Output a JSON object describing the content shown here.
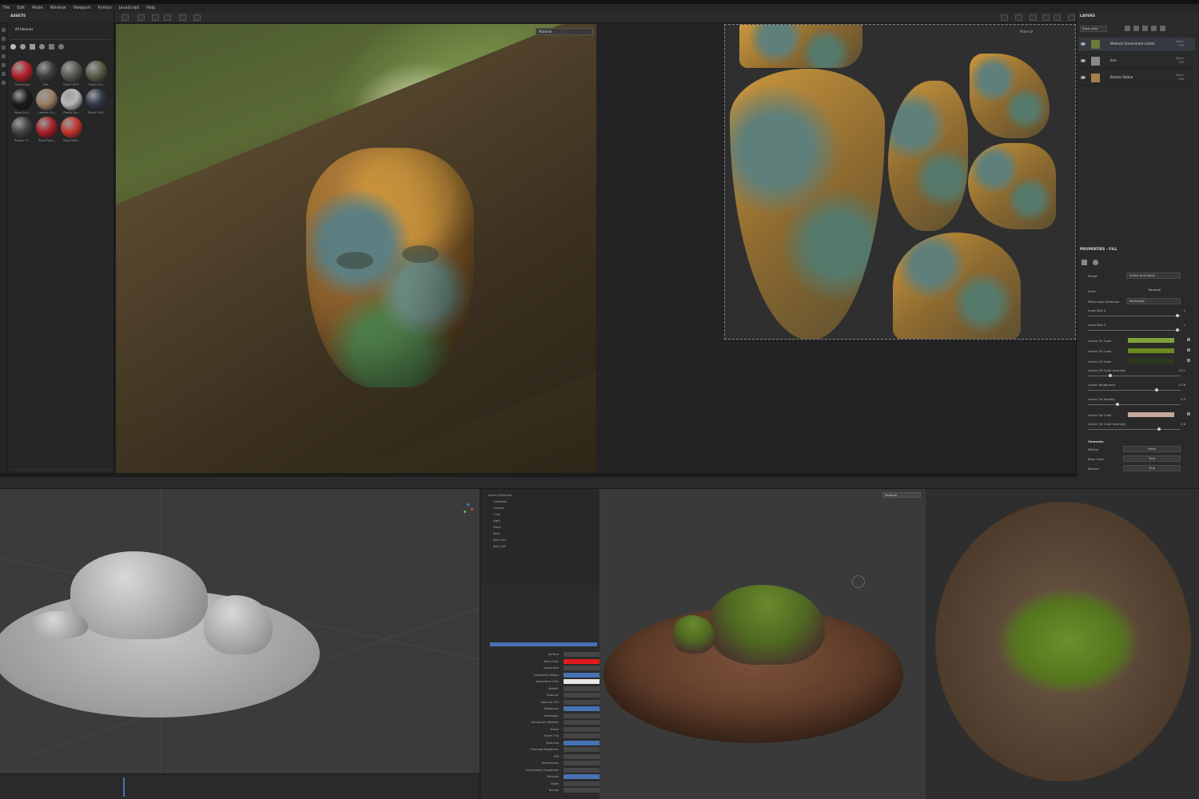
{
  "menu": [
    "File",
    "Edit",
    "Mode",
    "Window",
    "Viewport",
    "Python",
    "JavaScript",
    "Help"
  ],
  "assets": {
    "title": "ASSETS",
    "library": "All libraries",
    "materials": [
      {
        "label": "Aluminium",
        "color": "#b5202a"
      },
      {
        "label": "Bre...",
        "color": "#3c3c3c"
      },
      {
        "label": "Fabric UCP...",
        "color": "#5a5a52"
      },
      {
        "label": "Fabric Kni...",
        "color": "#5b5a45"
      },
      {
        "label": "Glass Sun...",
        "color": "#1a1a1a"
      },
      {
        "label": "Leather Sa...",
        "color": "#9a7c62"
      },
      {
        "label": "Plastic Dur...",
        "color": "#b8b8b8"
      },
      {
        "label": "Plastic Soft...",
        "color": "#303848"
      },
      {
        "label": "Rubber Ti...",
        "color": "#424242"
      },
      {
        "label": "Steel Paint...",
        "color": "#a62028"
      },
      {
        "label": "Steel Paint...",
        "color": "#c2342c"
      }
    ]
  },
  "viewport_3d": {
    "dropdown": "Material"
  },
  "uv_viewport": {
    "dropdown": "Material"
  },
  "layers": {
    "title": "LAYERS",
    "channel": "Base color",
    "items": [
      {
        "name": "Medium Scarecmora Lichen",
        "blend": "Norm",
        "opacity": "100",
        "thumb_color": "#6a7a3a"
      },
      {
        "name": "Iron",
        "blend": "Norm",
        "opacity": "100",
        "thumb_color": "#8a8a8a"
      },
      {
        "name": "Bronze Statue",
        "blend": "Norm",
        "opacity": "100",
        "thumb_color": "#a5804a"
      }
    ]
  },
  "properties": {
    "title": "PROPERTIES - FILL",
    "preset": {
      "label": "Preset",
      "value": "Select and Apply"
    },
    "seed": {
      "label": "Seed",
      "value": "Random"
    },
    "mask": {
      "label": "Mask Input Selection",
      "value": "Rectangle"
    },
    "sliders_a": [
      {
        "label": "Input Size X",
        "value": "1",
        "fraction": 0.98
      },
      {
        "label": "Input Size Y",
        "value": "1",
        "fraction": 0.98
      }
    ],
    "colors_a": [
      {
        "label": "Lichen 01 Color",
        "color": "#7fa23a"
      },
      {
        "label": "Lichen 02 Color",
        "color": "#6a8a1e"
      },
      {
        "label": "Lichen 03 Color",
        "color": "#2a3a1a"
      }
    ],
    "sliders_b": [
      {
        "label": "Lichen 03 Color Intensity",
        "value": "0.21",
        "fraction": 0.23
      },
      {
        "label": "Lichen Roughness",
        "value": "0.76",
        "fraction": 0.75
      },
      {
        "label": "Lichen 04 Density",
        "value": "0.3",
        "fraction": 0.31
      }
    ],
    "colors_b": [
      {
        "label": "Lichen 04 Color",
        "color": "#c9aaa0"
      }
    ],
    "sliders_c": [
      {
        "label": "Lichen 04 Color Intensity",
        "value": "0.8",
        "fraction": 0.78
      }
    ],
    "channels": {
      "title": "Channels",
      "items": [
        {
          "label": "Diffuse",
          "value": "False"
        },
        {
          "label": "Base Color",
          "value": "True"
        },
        {
          "label": "Normal",
          "value": "True"
        }
      ]
    }
  },
  "blender": {
    "outliner": [
      "Scene Collection",
      "Collection",
      "Camera",
      "Cube",
      "Light",
      "Plane",
      "Rock",
      "Rock.001",
      "Rock.002"
    ],
    "props": [
      "Surface",
      "Base Color",
      "Subsurface",
      "Subsurface Radius",
      "Subsurface Color",
      "Metallic",
      "Specular",
      "Specular Tint",
      "Roughness",
      "Anisotropic",
      "Anisotropic Rotation",
      "Sheen",
      "Sheen Tint",
      "Clearcoat",
      "Clearcoat Roughness",
      "IOR",
      "Transmission",
      "Transmission Roughness",
      "Emission",
      "Alpha",
      "Normal"
    ],
    "accent": "#4772b3",
    "base_color": "#e01a1a"
  },
  "mixer": {
    "dropdown": "Material"
  }
}
